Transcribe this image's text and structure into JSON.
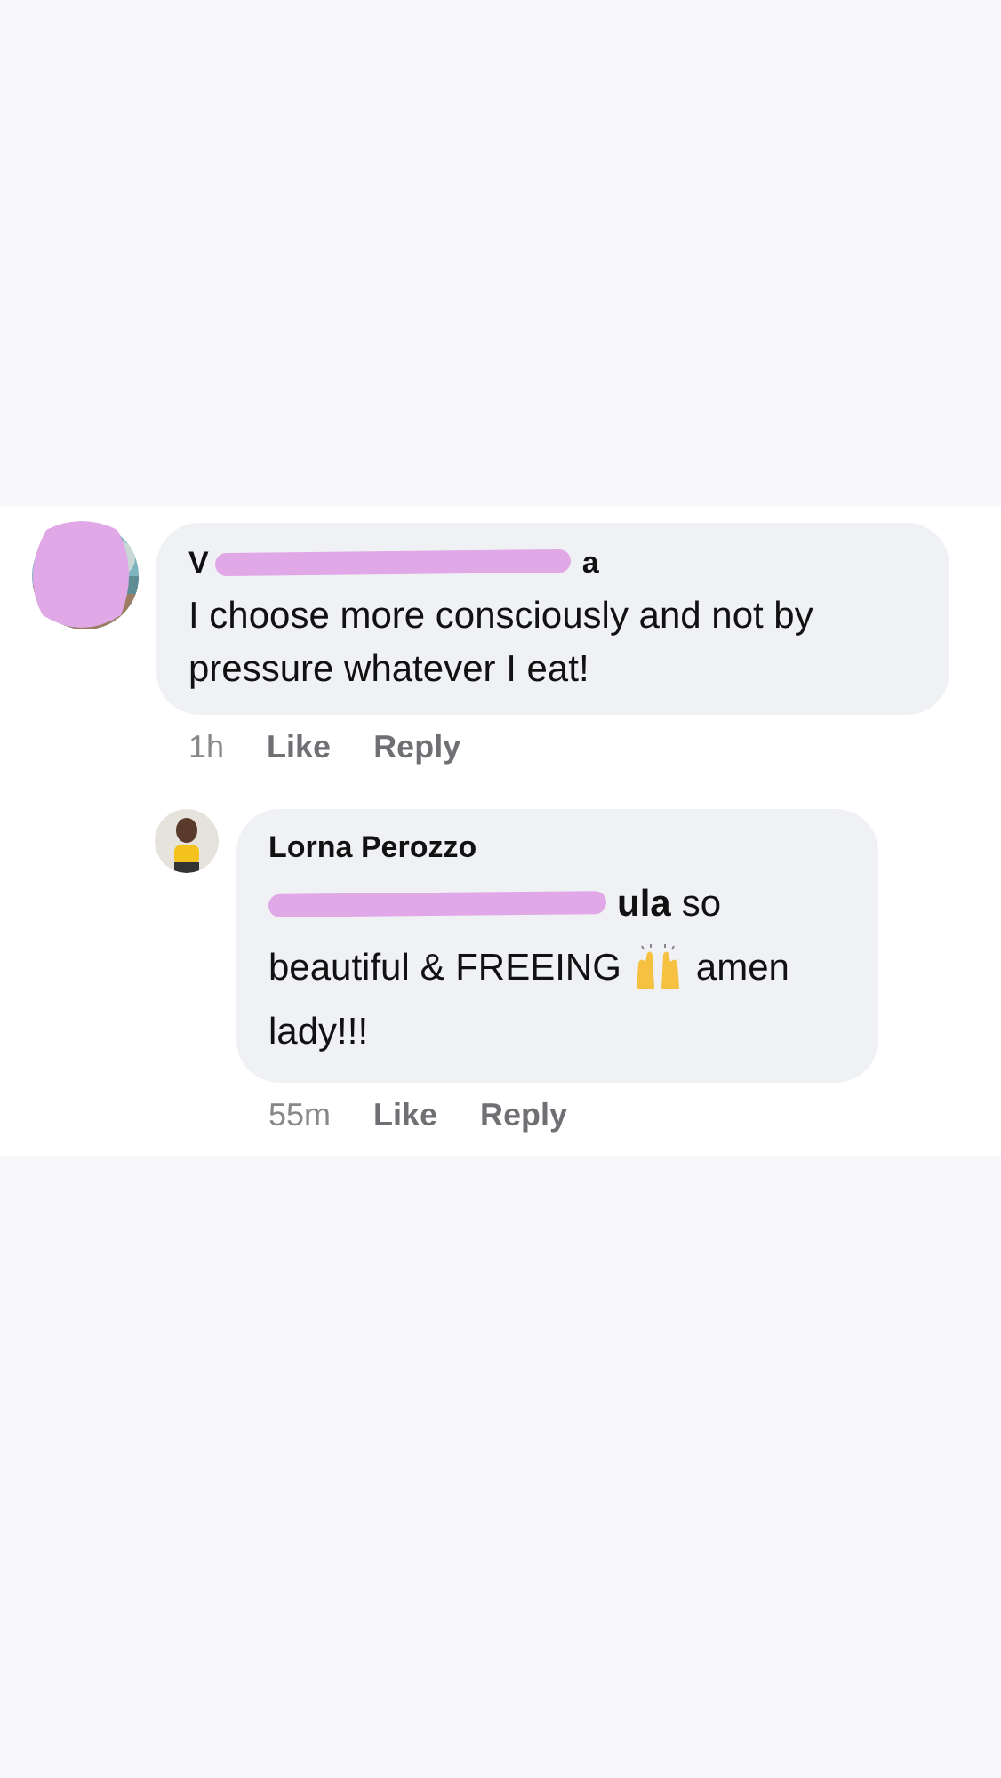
{
  "comments": [
    {
      "author_start": "V",
      "author_end": "a",
      "redacted": true,
      "avatar_redacted": true,
      "text": "I choose more consciously and not by pressure whatever I eat!",
      "time": "1h",
      "like": "Like",
      "reply": "Reply",
      "replies": [
        {
          "author": "Lorna Perozzo",
          "body": [
            [
              {
                "kind": "redacted"
              },
              {
                "kind": "mention",
                "text": "ula"
              },
              {
                "kind": "text",
                "text": "so"
              }
            ],
            [
              {
                "kind": "text",
                "text": "beautiful & FREEING"
              },
              {
                "kind": "emoji"
              },
              {
                "kind": "text",
                "text": "amen"
              }
            ],
            [
              {
                "kind": "text",
                "text": "lady!!!"
              }
            ]
          ],
          "time": "55m",
          "like": "Like",
          "reply": "Reply"
        }
      ]
    }
  ]
}
